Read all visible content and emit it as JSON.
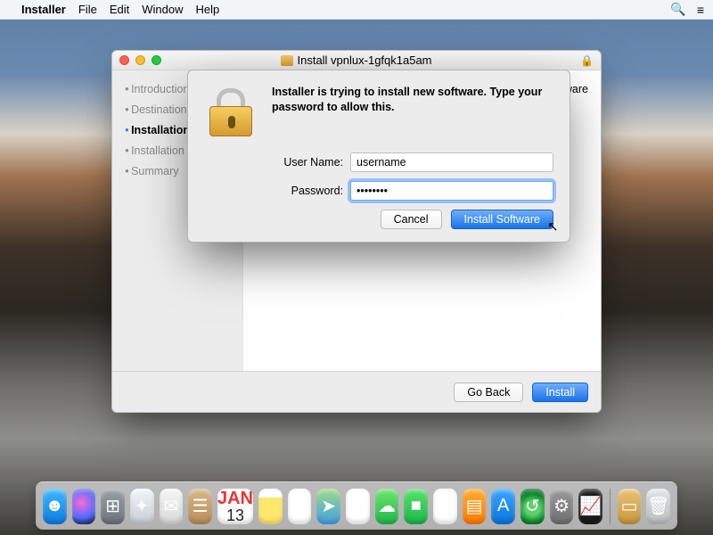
{
  "menubar": {
    "app": "Installer",
    "items": [
      "File",
      "Edit",
      "Window",
      "Help"
    ]
  },
  "installer": {
    "title": "Install vpnlux-1gfqk1a5am",
    "steps": [
      "Introduction",
      "Destination Select",
      "Installation Type",
      "Installation",
      "Summary"
    ],
    "active_step_index": 2,
    "content_truncated_word": "oftware",
    "buttons": {
      "back": "Go Back",
      "install": "Install"
    }
  },
  "auth": {
    "heading": "Installer is trying to install new software. Type your password to allow this.",
    "username_label": "User Name:",
    "password_label": "Password:",
    "username_value": "username",
    "password_value": "••••••••",
    "cancel": "Cancel",
    "submit": "Install Software"
  },
  "calendar": {
    "month": "JAN",
    "day": "13"
  },
  "dock": {
    "items": [
      {
        "name": "finder-icon",
        "cls": "finder",
        "glyph": "☻"
      },
      {
        "name": "siri-icon",
        "cls": "siri",
        "glyph": ""
      },
      {
        "name": "launchpad-icon",
        "cls": "launchpad",
        "glyph": "⊞"
      },
      {
        "name": "safari-icon",
        "cls": "safari",
        "glyph": "✦"
      },
      {
        "name": "mail-icon",
        "cls": "mail",
        "glyph": "✉"
      },
      {
        "name": "contacts-icon",
        "cls": "contacts",
        "glyph": "☰"
      },
      {
        "name": "calendar-icon",
        "cls": "calendar",
        "glyph": ""
      },
      {
        "name": "notes-icon",
        "cls": "notes",
        "glyph": ""
      },
      {
        "name": "reminders-icon",
        "cls": "reminders",
        "glyph": "☑"
      },
      {
        "name": "maps-icon",
        "cls": "maps",
        "glyph": "➤"
      },
      {
        "name": "photos-icon",
        "cls": "photos",
        "glyph": "❀"
      },
      {
        "name": "messages-icon",
        "cls": "messages",
        "glyph": "☁"
      },
      {
        "name": "facetime-icon",
        "cls": "facetime",
        "glyph": "■"
      },
      {
        "name": "itunes-icon",
        "cls": "itunes",
        "glyph": "♫"
      },
      {
        "name": "ibooks-icon",
        "cls": "ibooks",
        "glyph": "▤"
      },
      {
        "name": "appstore-icon",
        "cls": "appstore",
        "glyph": "A"
      },
      {
        "name": "timemachine-icon",
        "cls": "tmachine",
        "glyph": "↺"
      },
      {
        "name": "sysprefs-icon",
        "cls": "sysprefs",
        "glyph": "⚙"
      },
      {
        "name": "activity-icon",
        "cls": "activity",
        "glyph": "📈"
      },
      {
        "name": "installer-pkg-icon",
        "cls": "pkg",
        "glyph": "▭"
      },
      {
        "name": "trash-icon",
        "cls": "trash",
        "glyph": "🗑"
      }
    ]
  }
}
